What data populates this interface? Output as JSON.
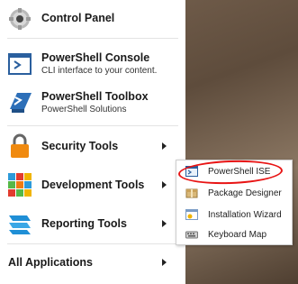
{
  "menu": {
    "items": [
      {
        "title": "Control Panel",
        "subtitle": "",
        "icon": "gear-icon",
        "has_arrow": false
      },
      {
        "title": "PowerShell Console",
        "subtitle": "CLI interface to your content.",
        "icon": "powershell-console-icon",
        "has_arrow": false
      },
      {
        "title": "PowerShell Toolbox",
        "subtitle": "PowerShell Solutions",
        "icon": "powershell-toolbox-icon",
        "has_arrow": false
      },
      {
        "title": "Security Tools",
        "subtitle": "",
        "icon": "lock-icon",
        "has_arrow": true
      },
      {
        "title": "Development Tools",
        "subtitle": "",
        "icon": "development-blocks-icon",
        "has_arrow": true
      },
      {
        "title": "Reporting Tools",
        "subtitle": "",
        "icon": "reporting-icon",
        "has_arrow": true
      }
    ],
    "all_applications": "All Applications"
  },
  "submenu": {
    "items": [
      {
        "label": "PowerShell ISE",
        "icon": "powershell-ise-icon",
        "circled": true
      },
      {
        "label": "Package Designer",
        "icon": "package-icon",
        "circled": false
      },
      {
        "label": "Installation Wizard",
        "icon": "installation-wizard-icon",
        "circled": false
      },
      {
        "label": "Keyboard Map",
        "icon": "keyboard-icon",
        "circled": false
      }
    ]
  },
  "colors": {
    "annotation": "#e81414",
    "menu_bg": "#ffffff"
  }
}
